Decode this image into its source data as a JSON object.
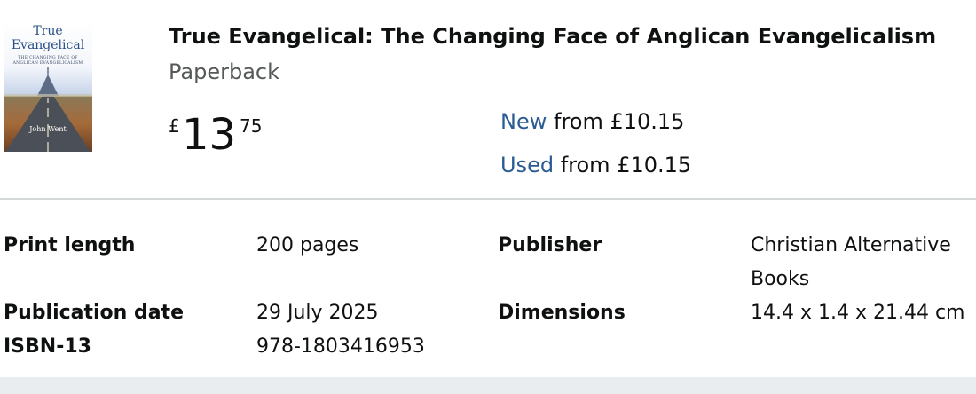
{
  "product": {
    "title": "True Evangelical: The Changing Face of Anglican Evangelicalism",
    "format": "Paperback",
    "price": {
      "currency_symbol": "£",
      "whole": "13",
      "fraction": "75"
    },
    "offers": {
      "new_label": "New",
      "new_text": " from £10.15",
      "used_label": "Used",
      "used_text": " from £10.15"
    },
    "cover": {
      "title_line1": "True",
      "title_line2": "Evangelical",
      "subtitle_line1": "THE CHANGING FACE OF",
      "subtitle_line2": "ANGLICAN EVANGELICALISM",
      "author": "John Went"
    }
  },
  "details": {
    "print_length_label": "Print length",
    "print_length_value": "200 pages",
    "publisher_label": "Publisher",
    "publisher_value": "Christian Alternative Books",
    "publication_date_label": "Publication date",
    "publication_date_value": "29 July 2025",
    "dimensions_label": "Dimensions",
    "dimensions_value": "14.4 x 1.4 x 21.44 cm",
    "isbn_label": "ISBN-13",
    "isbn_value": "978-1803416953"
  },
  "colors": {
    "link": "#2a5b92",
    "text": "#0f1111",
    "muted": "#565959",
    "divider": "#d5d9d9",
    "footer_band": "#eaedf0"
  }
}
